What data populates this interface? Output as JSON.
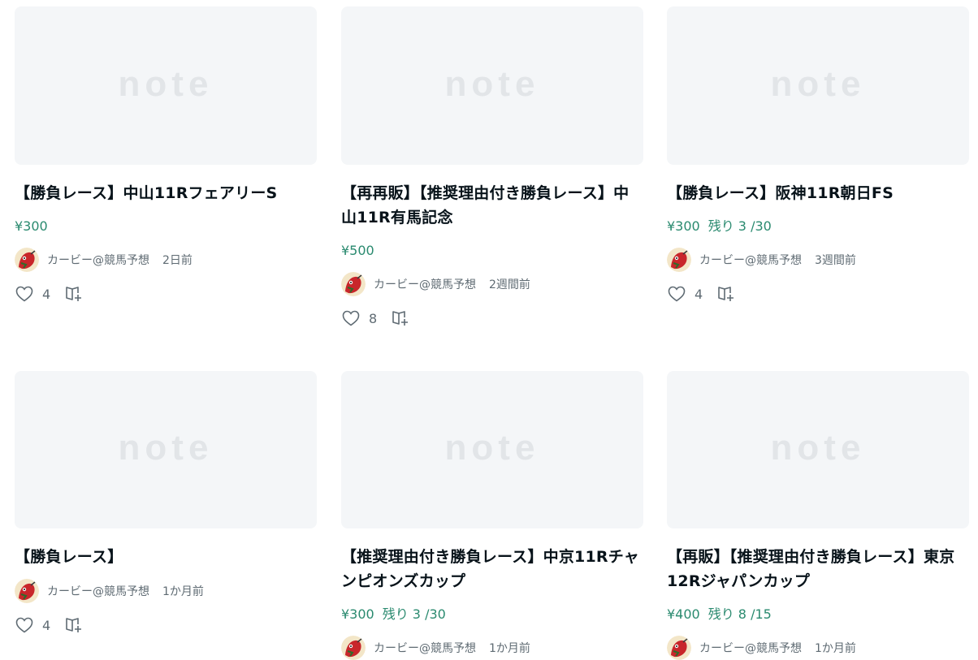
{
  "cards": [
    {
      "thumb_logo": "note",
      "title": "【勝負レース】中山11RフェアリーS",
      "price": "¥300",
      "remaining": "",
      "author": "カービー@競馬予想",
      "time": "2日前",
      "likes": "4",
      "icons": {
        "like": "heart-icon",
        "magazine": "magazine-add-icon"
      }
    },
    {
      "thumb_logo": "note",
      "title": "【再再販】【推奨理由付き勝負レース】中山11R有馬記念",
      "price": "¥500",
      "remaining": "",
      "author": "カービー@競馬予想",
      "time": "2週間前",
      "likes": "8",
      "icons": {
        "like": "heart-icon",
        "magazine": "magazine-add-icon"
      }
    },
    {
      "thumb_logo": "note",
      "title": "【勝負レース】阪神11R朝日FS",
      "price": "¥300",
      "remaining": "残り 3 /30",
      "author": "カービー@競馬予想",
      "time": "3週間前",
      "likes": "4",
      "icons": {
        "like": "heart-icon",
        "magazine": "magazine-add-icon"
      }
    },
    {
      "thumb_logo": "note",
      "title": "【勝負レース】",
      "price": "",
      "remaining": "",
      "author": "カービー@競馬予想",
      "time": "1か月前",
      "likes": "4",
      "icons": {
        "like": "heart-icon",
        "magazine": "magazine-add-icon"
      }
    },
    {
      "thumb_logo": "note",
      "title": "【推奨理由付き勝負レース】中京11Rチャンピオンズカップ",
      "price": "¥300",
      "remaining": "残り 3 /30",
      "author": "カービー@競馬予想",
      "time": "1か月前",
      "likes": "",
      "icons": {
        "like": "heart-icon",
        "magazine": "magazine-add-icon"
      }
    },
    {
      "thumb_logo": "note",
      "title": "【再販】【推奨理由付き勝負レース】東京12Rジャパンカップ",
      "price": "¥400",
      "remaining": "残り 8 /15",
      "author": "カービー@競馬予想",
      "time": "1か月前",
      "likes": "",
      "icons": {
        "like": "heart-icon",
        "magazine": "magazine-add-icon"
      }
    }
  ],
  "colors": {
    "thumb_bg": "#f4f6f8",
    "logo": "#e2e5e8",
    "price": "#2a8a6f",
    "meta": "#5f6b73",
    "title": "#08131a"
  }
}
